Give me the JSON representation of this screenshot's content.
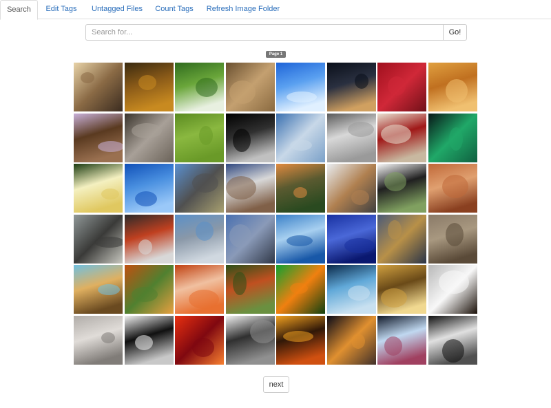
{
  "tabs": [
    {
      "label": "Search",
      "active": true
    },
    {
      "label": "Edit Tags",
      "active": false
    },
    {
      "label": "Untagged Files",
      "active": false
    },
    {
      "label": "Count Tags",
      "active": false
    },
    {
      "label": "Refresh Image Folder",
      "active": false
    }
  ],
  "search": {
    "placeholder": "Search for...",
    "value": "",
    "go_label": "Go!"
  },
  "pagination": {
    "page_label": "Page 1",
    "next_label": "next"
  },
  "thumbnails": [
    {
      "name": "beach-sunset-thumbnail",
      "colors": [
        "#e8d3a8",
        "#8a6a45",
        "#3b2c20"
      ]
    },
    {
      "name": "forest-night-thumbnail",
      "colors": [
        "#3a2a10",
        "#8a5a18",
        "#c88a20"
      ]
    },
    {
      "name": "dandelion-thumbnail",
      "colors": [
        "#2f6b1e",
        "#6aa63a",
        "#e8f0e0"
      ]
    },
    {
      "name": "gold-coin-thumbnail",
      "colors": [
        "#6a5030",
        "#c4a070",
        "#8a6a40"
      ]
    },
    {
      "name": "blue-sky-thumbnail",
      "colors": [
        "#1e64d8",
        "#5aa0f0",
        "#e0f0ff"
      ]
    },
    {
      "name": "city-night-thumbnail",
      "colors": [
        "#0a0f1a",
        "#2a3040",
        "#d0a060"
      ]
    },
    {
      "name": "raspberries-thumbnail",
      "colors": [
        "#a0101e",
        "#d02838",
        "#701018"
      ]
    },
    {
      "name": "wheat-field-thumbnail",
      "colors": [
        "#e0a040",
        "#c07020",
        "#f0c070"
      ]
    },
    {
      "name": "yorkshire-dog-thumbnail",
      "colors": [
        "#c8b0d8",
        "#5a3a20",
        "#9a7050"
      ]
    },
    {
      "name": "old-man-thumbnail",
      "colors": [
        "#3a342c",
        "#a8a098",
        "#6a6258"
      ]
    },
    {
      "name": "grass-texture-thumbnail",
      "colors": [
        "#5a8a20",
        "#8ab840",
        "#6a9a28"
      ]
    },
    {
      "name": "dark-corridor-thumbnail",
      "colors": [
        "#000000",
        "#303030",
        "#c0c0c0"
      ]
    },
    {
      "name": "clouds-thumbnail",
      "colors": [
        "#3a70b0",
        "#c8d8e8",
        "#7aa0c8"
      ]
    },
    {
      "name": "angel-statue-thumbnail",
      "colors": [
        "#5a5a5a",
        "#d8d8d8",
        "#9a9a9a"
      ]
    },
    {
      "name": "red-door-thumbnail",
      "colors": [
        "#e8e0d0",
        "#a01818",
        "#c8b8a0"
      ]
    },
    {
      "name": "aurora-thumbnail",
      "colors": [
        "#081818",
        "#20a868",
        "#106040"
      ]
    },
    {
      "name": "water-lily-thumbnail",
      "colors": [
        "#1a3a10",
        "#f4f0c0",
        "#e0c860"
      ]
    },
    {
      "name": "water-drops-thumbnail",
      "colors": [
        "#1050b8",
        "#4a90e0",
        "#9ac8f8"
      ]
    },
    {
      "name": "road-thumbnail",
      "colors": [
        "#5a90d0",
        "#505050",
        "#a8a070"
      ]
    },
    {
      "name": "radio-telescope-thumbnail",
      "colors": [
        "#304880",
        "#d8d8d8",
        "#806048"
      ]
    },
    {
      "name": "hills-sunset-thumbnail",
      "colors": [
        "#e08a40",
        "#5a5a30",
        "#2a4a20"
      ]
    },
    {
      "name": "pocket-watch-thumbnail",
      "colors": [
        "#e8ecf0",
        "#b08050",
        "#404040"
      ]
    },
    {
      "name": "wedding-thumbnail",
      "colors": [
        "#f8f8f8",
        "#202020",
        "#80a060"
      ]
    },
    {
      "name": "desert-thumbnail",
      "colors": [
        "#c06838",
        "#e0a070",
        "#8a4020"
      ]
    },
    {
      "name": "pier-thumbnail",
      "colors": [
        "#909898",
        "#3a3a38",
        "#c8c8c0"
      ]
    },
    {
      "name": "typewriter-thumbnail",
      "colors": [
        "#2a2a2a",
        "#c04020",
        "#d8d8d8"
      ]
    },
    {
      "name": "skyscrapers-thumbnail",
      "colors": [
        "#5a90c8",
        "#8a98a8",
        "#d0d8e0"
      ]
    },
    {
      "name": "space-needle-thumbnail",
      "colors": [
        "#4a70b0",
        "#8a9ab8",
        "#303848"
      ]
    },
    {
      "name": "mosaic-tiles-thumbnail",
      "colors": [
        "#3a80c8",
        "#a8d0f0",
        "#1858a8"
      ]
    },
    {
      "name": "blue-stones-thumbnail",
      "colors": [
        "#1830a0",
        "#4a68d8",
        "#0a1870"
      ]
    },
    {
      "name": "old-keys-thumbnail",
      "colors": [
        "#4a5a78",
        "#b89048",
        "#2a3448"
      ]
    },
    {
      "name": "wood-planks-thumbnail",
      "colors": [
        "#8a7a68",
        "#a89880",
        "#5a4a38"
      ]
    },
    {
      "name": "horse-thumbnail",
      "colors": [
        "#70c0e0",
        "#e0b060",
        "#6a4a20"
      ]
    },
    {
      "name": "autumn-trees-thumbnail",
      "colors": [
        "#c05010",
        "#508030",
        "#e8a040"
      ]
    },
    {
      "name": "red-hair-woman-thumbnail",
      "colors": [
        "#c04010",
        "#f0c0a0",
        "#e87030"
      ]
    },
    {
      "name": "park-path-thumbnail",
      "colors": [
        "#2a5018",
        "#c05020",
        "#6a9040"
      ]
    },
    {
      "name": "bird-of-paradise-thumbnail",
      "colors": [
        "#10a030",
        "#f08010",
        "#104010"
      ]
    },
    {
      "name": "broken-glass-thumbnail",
      "colors": [
        "#0a2848",
        "#60a8d8",
        "#c8e0f0"
      ]
    },
    {
      "name": "misty-forest-thumbnail",
      "colors": [
        "#d0a040",
        "#6a4a18",
        "#f0d890"
      ]
    },
    {
      "name": "coffee-cup-thumbnail",
      "colors": [
        "#b8b8b8",
        "#f8f8f8",
        "#1a1008"
      ]
    },
    {
      "name": "sand-hearts-thumbnail",
      "colors": [
        "#b0aca8",
        "#e0dcd8",
        "#807c78"
      ]
    },
    {
      "name": "chess-pieces-thumbnail",
      "colors": [
        "#f0f0f0",
        "#101010",
        "#c8c8c8"
      ]
    },
    {
      "name": "red-sky-thumbnail",
      "colors": [
        "#e83010",
        "#800810",
        "#f88030"
      ]
    },
    {
      "name": "curved-steps-thumbnail",
      "colors": [
        "#f0f0f0",
        "#303030",
        "#909090"
      ]
    },
    {
      "name": "orange-sunset-thumbnail",
      "colors": [
        "#f0a020",
        "#301808",
        "#d05010"
      ]
    },
    {
      "name": "refinery-night-thumbnail",
      "colors": [
        "#0a0a18",
        "#e09030",
        "#40302a"
      ]
    },
    {
      "name": "skyline-night-thumbnail",
      "colors": [
        "#101828",
        "#c0d8f0",
        "#a04060"
      ]
    },
    {
      "name": "pearls-woman-thumbnail",
      "colors": [
        "#101010",
        "#e0e0e0",
        "#505050"
      ]
    }
  ]
}
